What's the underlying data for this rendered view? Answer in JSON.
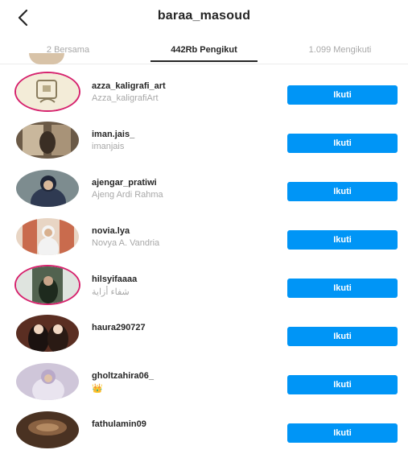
{
  "header": {
    "back_icon": "chevron-left-icon",
    "title": "baraa_masoud"
  },
  "tabs": [
    {
      "label": "2 Bersama",
      "active": false
    },
    {
      "label": "442Rb Pengikut",
      "active": true
    },
    {
      "label": "1.099 Mengikuti",
      "active": false
    }
  ],
  "colors": {
    "follow_button": "#0095f6",
    "story_ring": "#d6246e",
    "secondary_text": "#a8a8a8"
  },
  "followers": [
    {
      "username": "azza_kaligrafi_art",
      "full_name": "Azza_kaligrafiArt",
      "button": "Ikuti"
    },
    {
      "username": "iman.jais_",
      "full_name": "imanjais",
      "button": "Ikuti"
    },
    {
      "username": "ajengar_pratiwi",
      "full_name": "Ajeng Ardi Rahma",
      "button": "Ikuti"
    },
    {
      "username": "novia.lya",
      "full_name": "Novya A. Vandria",
      "button": "Ikuti"
    },
    {
      "username": "hilsyifaaaa",
      "full_name": "شفاء أزاية",
      "button": "Ikuti"
    },
    {
      "username": "haura290727",
      "full_name": "",
      "button": "Ikuti"
    },
    {
      "username": "gholtzahira06_",
      "full_name": "👑",
      "button": "Ikuti"
    },
    {
      "username": "fathulamin09",
      "full_name": "",
      "button": "Ikuti"
    }
  ]
}
